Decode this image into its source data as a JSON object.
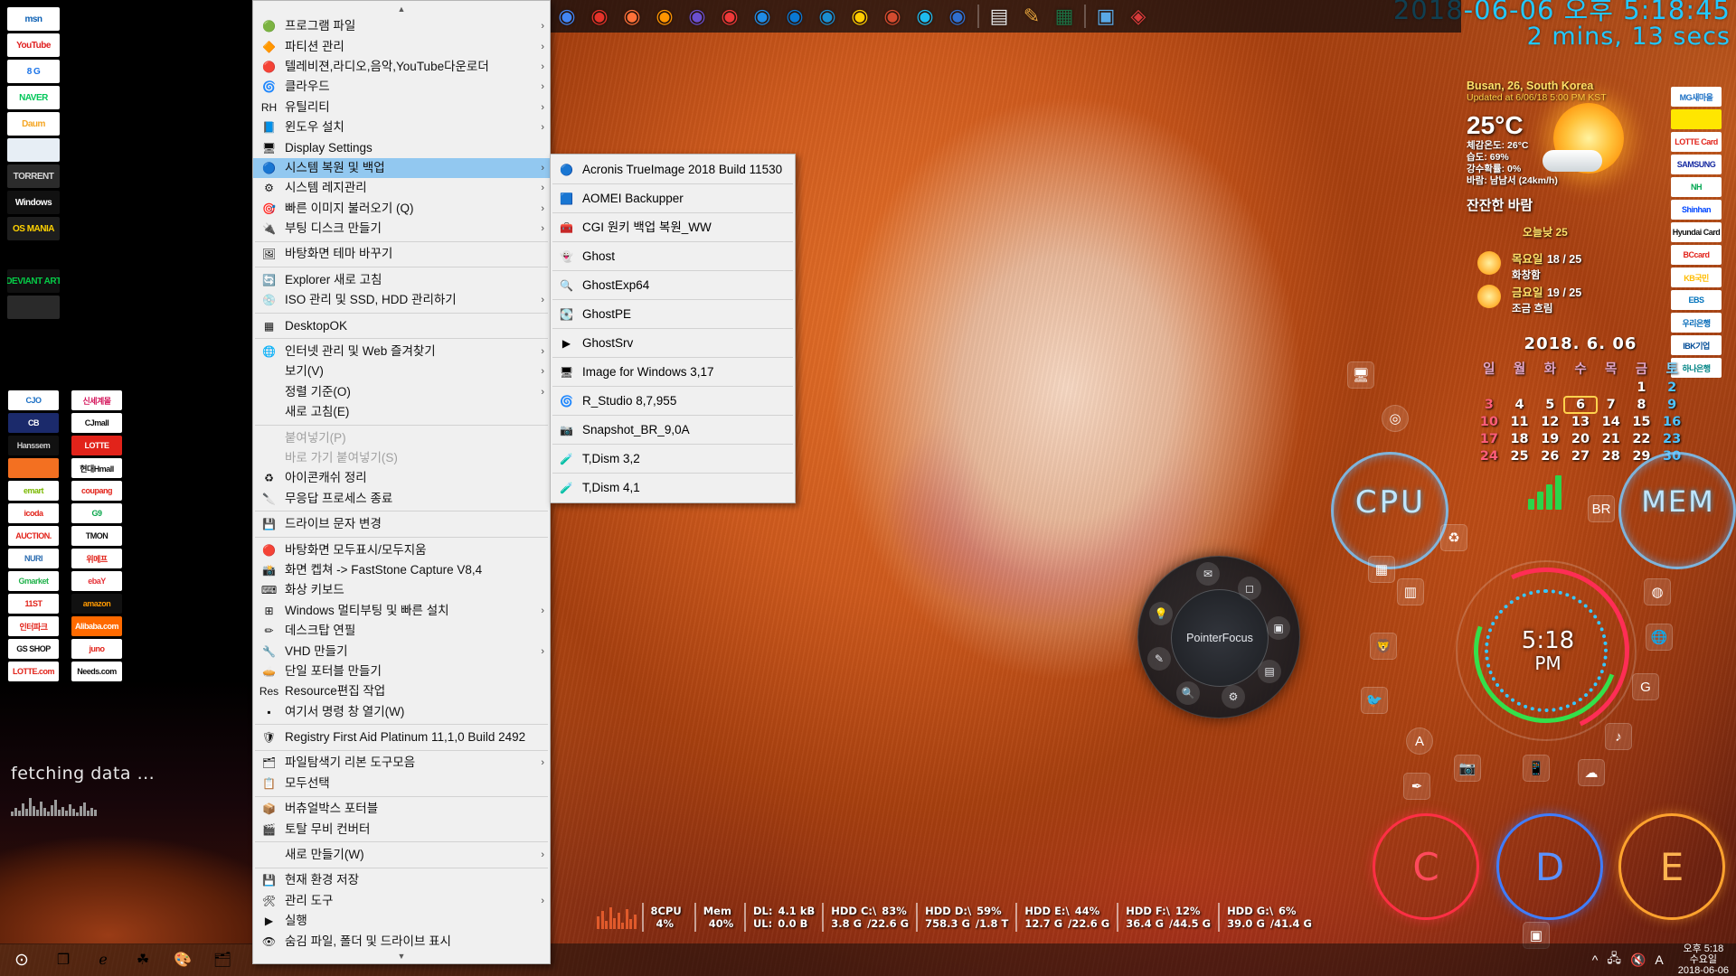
{
  "desktop": {
    "datetime_overlay": {
      "line1": "2018-06-06 오후 5:18:45",
      "line2": "2 mins, 13 secs"
    },
    "fetching": {
      "title": "fetching data ..."
    }
  },
  "icons_left_col1": [
    {
      "name": "msn",
      "label": "msn",
      "bg": "#ffffff",
      "fg": "#0a5fb4"
    },
    {
      "name": "youtube",
      "label": "YouTube",
      "bg": "#ffffff",
      "fg": "#e02020"
    },
    {
      "name": "google",
      "label": "8  G",
      "bg": "#ffffff",
      "fg": "#1a73e8"
    },
    {
      "name": "naver",
      "label": "NAVER",
      "bg": "#ffffff",
      "fg": "#03c75a"
    },
    {
      "name": "daum",
      "label": "Daum",
      "bg": "#ffffff",
      "fg": "#f5a623"
    },
    {
      "name": "news-portal",
      "label": "",
      "bg": "#e7eef5",
      "fg": "#333333"
    },
    {
      "name": "torrent",
      "label": "TORRENT",
      "bg": "#2b2b2b",
      "fg": "#d8d8d8"
    },
    {
      "name": "windows-forum",
      "label": "Windows",
      "bg": "#111111",
      "fg": "#ffffff"
    },
    {
      "name": "os-mania",
      "label": "OS MANIA",
      "bg": "#1e1e1e",
      "fg": "#ffd200"
    },
    {
      "name": "windows-logo",
      "label": "",
      "bg": "#000000",
      "fg": "#35b7f0"
    },
    {
      "name": "deviantart",
      "label": "DEVIANT ART",
      "bg": "#111111",
      "fg": "#05cc47"
    },
    {
      "name": "obsidian",
      "label": "",
      "bg": "#2a2a2a",
      "fg": "#cccccc"
    },
    {
      "name": "red-bird",
      "label": "",
      "bg": "#000000",
      "fg": "#d14a32"
    },
    {
      "name": "korea-flag",
      "label": "",
      "bg": "#000000",
      "fg": "#ffffff"
    }
  ],
  "icons_shop_col1": [
    {
      "name": "cjo",
      "label": "CJO",
      "bg": "#ffffff",
      "fg": "#1a6fc4"
    },
    {
      "name": "cb-mall",
      "label": "CB",
      "bg": "#1b2a6b",
      "fg": "#ffffff"
    },
    {
      "name": "hanssem",
      "label": "Hanssem",
      "bg": "#111111",
      "fg": "#cccccc"
    },
    {
      "name": "ssg-orange",
      "label": "",
      "bg": "#f37021",
      "fg": "#ffffff"
    },
    {
      "name": "emart-mall",
      "label": "emart",
      "bg": "#ffffff",
      "fg": "#7ab800"
    },
    {
      "name": "icoda",
      "label": "icoda",
      "bg": "#ffffff",
      "fg": "#e2231a"
    },
    {
      "name": "auction",
      "label": "AUCTION.",
      "bg": "#ffffff",
      "fg": "#e2231a"
    },
    {
      "name": "nuri",
      "label": "NURI",
      "bg": "#ffffff",
      "fg": "#2b6cb0"
    },
    {
      "name": "gmarket",
      "label": "Gmarket",
      "bg": "#ffffff",
      "fg": "#21b24b"
    },
    {
      "name": "11st",
      "label": "11ST",
      "bg": "#ffffff",
      "fg": "#e2231a"
    },
    {
      "name": "interpark",
      "label": "인터파크",
      "bg": "#ffffff",
      "fg": "#e2231a"
    },
    {
      "name": "gsshop",
      "label": "GS SHOP",
      "bg": "#ffffff",
      "fg": "#111111"
    },
    {
      "name": "lotte-com",
      "label": "LOTTE.com",
      "bg": "#ffffff",
      "fg": "#e2231a"
    }
  ],
  "icons_shop_col2": [
    {
      "name": "shinsegae",
      "label": "신세계몰",
      "bg": "#ffffff",
      "fg": "#d4145a"
    },
    {
      "name": "cjmall",
      "label": "CJmall",
      "bg": "#ffffff",
      "fg": "#111111"
    },
    {
      "name": "lotte-homeshopping",
      "label": "LOTTE",
      "bg": "#e2231a",
      "fg": "#ffffff"
    },
    {
      "name": "hmall",
      "label": "현대Hmall",
      "bg": "#ffffff",
      "fg": "#111111"
    },
    {
      "name": "coupang",
      "label": "coupang",
      "bg": "#ffffff",
      "fg": "#e2231a"
    },
    {
      "name": "g9",
      "label": "G9",
      "bg": "#ffffff",
      "fg": "#0aa64b"
    },
    {
      "name": "tmon",
      "label": "TMON",
      "bg": "#ffffff",
      "fg": "#111111"
    },
    {
      "name": "wemakeprice",
      "label": "위메프",
      "bg": "#ffffff",
      "fg": "#e2231a"
    },
    {
      "name": "ebay",
      "label": "ebaY",
      "bg": "#ffffff",
      "fg": "#e53238"
    },
    {
      "name": "amazon",
      "label": "amazon",
      "bg": "#111111",
      "fg": "#ff9900"
    },
    {
      "name": "alibaba",
      "label": "Alibaba.com",
      "bg": "#ff6a00",
      "fg": "#ffffff"
    },
    {
      "name": "hmall-juno",
      "label": "juno",
      "bg": "#ffffff",
      "fg": "#e2231a"
    },
    {
      "name": "needsgom",
      "label": "Needs.com",
      "bg": "#ffffff",
      "fg": "#111111"
    }
  ],
  "icons_right_rail": [
    {
      "name": "mg-saemaeul",
      "label": "MG새마을",
      "bg": "#ffffff",
      "fg": "#1a6fc4"
    },
    {
      "name": "kakao-bank",
      "label": "",
      "bg": "#ffe600",
      "fg": "#3c1e1e"
    },
    {
      "name": "lotte-card",
      "label": "LOTTE Card",
      "bg": "#ffffff",
      "fg": "#e2231a"
    },
    {
      "name": "samsung-card",
      "label": "SAMSUNG",
      "bg": "#ffffff",
      "fg": "#1428a0"
    },
    {
      "name": "nh-bank",
      "label": "NH",
      "bg": "#ffffff",
      "fg": "#00a650"
    },
    {
      "name": "shinhan",
      "label": "Shinhan",
      "bg": "#ffffff",
      "fg": "#0046ff"
    },
    {
      "name": "hyundai-card",
      "label": "Hyundai Card",
      "bg": "#ffffff",
      "fg": "#111111"
    },
    {
      "name": "bc-card",
      "label": "BCcard",
      "bg": "#ffffff",
      "fg": "#e2231a"
    },
    {
      "name": "kb-card",
      "label": "KB국민",
      "bg": "#ffffff",
      "fg": "#ffbc00"
    },
    {
      "name": "ebs",
      "label": "EBS",
      "bg": "#ffffff",
      "fg": "#0072bc"
    },
    {
      "name": "woori-bank",
      "label": "우리은행",
      "bg": "#ffffff",
      "fg": "#0068b7"
    },
    {
      "name": "ibk",
      "label": "IBK기업",
      "bg": "#ffffff",
      "fg": "#004c97"
    },
    {
      "name": "hana-bank",
      "label": "하나은행",
      "bg": "#ffffff",
      "fg": "#008485"
    }
  ],
  "quicklaunch": {
    "items": [
      {
        "name": "chrome",
        "glyph": "◉",
        "color": "#4285f4"
      },
      {
        "name": "opera",
        "glyph": "◉",
        "color": "#e5332a"
      },
      {
        "name": "firefox",
        "glyph": "◉",
        "color": "#ff7139"
      },
      {
        "name": "firefox-dev",
        "glyph": "◉",
        "color": "#ff9500"
      },
      {
        "name": "firefox-nightly",
        "glyph": "◉",
        "color": "#6a4fcf"
      },
      {
        "name": "vivaldi",
        "glyph": "◉",
        "color": "#ef3939"
      },
      {
        "name": "naver-whale",
        "glyph": "◉",
        "color": "#1f8ce6"
      },
      {
        "name": "edge",
        "glyph": "◉",
        "color": "#0a78d4"
      },
      {
        "name": "waterfox",
        "glyph": "◉",
        "color": "#1a8ed1"
      },
      {
        "name": "yandex",
        "glyph": "◉",
        "color": "#ffcc00"
      },
      {
        "name": "torch",
        "glyph": "◉",
        "color": "#d44b2f"
      },
      {
        "name": "internet-explorer",
        "glyph": "◉",
        "color": "#1ebbee"
      },
      {
        "name": "maxthon",
        "glyph": "◉",
        "color": "#2f6fd0"
      },
      {
        "name": "notepad",
        "glyph": "▤",
        "color": "#e8e8e8"
      },
      {
        "name": "pencil",
        "glyph": "✎",
        "color": "#e8a33d"
      },
      {
        "name": "excel",
        "glyph": "▦",
        "color": "#1d6f42"
      },
      {
        "name": "folder-blue",
        "glyph": "▣",
        "color": "#5aa9e6"
      },
      {
        "name": "app-red",
        "glyph": "◈",
        "color": "#d93b3b"
      }
    ]
  },
  "context_menu": {
    "items": [
      {
        "label": "프로그램 파일",
        "icon": "🟢",
        "arrow": true,
        "sep_after": false
      },
      {
        "label": "파티션 관리",
        "icon": "🔶",
        "arrow": true
      },
      {
        "label": "텔레비젼,라디오,음악,YouTube다운로더",
        "icon": "🔴",
        "arrow": true
      },
      {
        "label": "클라우드",
        "icon": "🌀",
        "arrow": true
      },
      {
        "label": "유틸리티",
        "icon": "RH",
        "arrow": true
      },
      {
        "label": "윈도우 설치",
        "icon": "📘",
        "arrow": true
      },
      {
        "label": "Display Settings",
        "icon": "🖥",
        "arrow": false
      },
      {
        "label": "시스템 복원 및 백업",
        "icon": "🔵",
        "arrow": true,
        "selected": true
      },
      {
        "label": "시스템 레지관리",
        "icon": "⚙",
        "arrow": true
      },
      {
        "label": "빠른 이미지 불러오기 (Q)",
        "icon": "🎯",
        "arrow": true
      },
      {
        "label": "부팅 디스크 만들기",
        "icon": "🔌",
        "arrow": true,
        "sep_after": true
      },
      {
        "label": "바탕화면 테마 바꾸기",
        "icon": "🖼",
        "arrow": false,
        "sep_after": true
      },
      {
        "label": "Explorer 새로 고침",
        "icon": "🔄",
        "arrow": false
      },
      {
        "label": "ISO 관리 및 SSD, HDD 관리하기",
        "icon": "💿",
        "arrow": true,
        "sep_after": true
      },
      {
        "label": "DesktopOK",
        "icon": "▦",
        "arrow": false,
        "sep_after": true
      },
      {
        "label": "인터넷 관리 및 Web 즐겨찾기",
        "icon": "🌐",
        "arrow": true
      },
      {
        "label": "보기(V)",
        "icon": "",
        "arrow": true
      },
      {
        "label": "정렬 기준(O)",
        "icon": "",
        "arrow": true
      },
      {
        "label": "새로 고침(E)",
        "icon": "",
        "arrow": false,
        "sep_after": true
      },
      {
        "label": "붙여넣기(P)",
        "icon": "",
        "arrow": false,
        "disabled": true
      },
      {
        "label": "바로 가기 붙여넣기(S)",
        "icon": "",
        "arrow": false,
        "disabled": true
      },
      {
        "label": "아이콘캐쉬 정리",
        "icon": "♻",
        "arrow": false
      },
      {
        "label": "무응답 프로세스 종료",
        "icon": "🔪",
        "arrow": false,
        "sep_after": true
      },
      {
        "label": "드라이브 문자 변경",
        "icon": "💾",
        "arrow": false,
        "sep_after": true
      },
      {
        "label": "바탕화면 모두표시/모두지움",
        "icon": "🔴",
        "arrow": false
      },
      {
        "label": "화면 켑쳐 -> FastStone Capture V8,4",
        "icon": "📸",
        "arrow": false
      },
      {
        "label": "화상 키보드",
        "icon": "⌨",
        "arrow": false
      },
      {
        "label": "Windows 멀티부팅 및 빠른 설치",
        "icon": "⊞",
        "arrow": true
      },
      {
        "label": "데스크탑 연필",
        "icon": "✏",
        "arrow": false
      },
      {
        "label": "VHD 만들기",
        "icon": "🔧",
        "arrow": true
      },
      {
        "label": "단일 포터블 만들기",
        "icon": "🥧",
        "arrow": false
      },
      {
        "label": "Resource편집 작업",
        "icon": "Res",
        "arrow": false
      },
      {
        "label": "여기서 명령 창 열기(W)",
        "icon": "▪",
        "arrow": false,
        "sep_after": true
      },
      {
        "label": "Registry First Aid Platinum 11,1,0 Build 2492",
        "icon": "🛡",
        "arrow": false,
        "sep_after": true
      },
      {
        "label": "파일탐색기 리본 도구모음",
        "icon": "🗂",
        "arrow": true
      },
      {
        "label": "모두선택",
        "icon": "📋",
        "arrow": false,
        "sep_after": true
      },
      {
        "label": "버츄얼박스 포터블",
        "icon": "📦",
        "arrow": false
      },
      {
        "label": "토탈 무비 컨버터",
        "icon": "🎬",
        "arrow": false,
        "sep_after": true
      },
      {
        "label": "새로 만들기(W)",
        "icon": "",
        "arrow": true,
        "sep_after": true
      },
      {
        "label": "현재 환경 저장",
        "icon": "💾",
        "arrow": false
      },
      {
        "label": "관리 도구",
        "icon": "🛠",
        "arrow": true
      },
      {
        "label": "실행",
        "icon": "▶",
        "arrow": false
      },
      {
        "label": "숨김 파일, 폴더 및 드라이브 표시",
        "icon": "👁",
        "arrow": false
      }
    ]
  },
  "submenu": {
    "title": "시스템 복원 및 백업",
    "items": [
      {
        "label": "Acronis TrueImage 2018 Build 11530",
        "icon": "🔵"
      },
      {
        "label": "AOMEI Backupper",
        "icon": "🟦"
      },
      {
        "label": "CGI 원키 백업 복원_WW",
        "icon": "🧰"
      },
      {
        "label": "Ghost",
        "icon": "👻"
      },
      {
        "label": "GhostExp64",
        "icon": "🔍"
      },
      {
        "label": "GhostPE",
        "icon": "💽"
      },
      {
        "label": "GhostSrv",
        "icon": "▶"
      },
      {
        "label": "Image for Windows 3,17",
        "icon": "🖥"
      },
      {
        "label": "R_Studio 8,7,955",
        "icon": "🌀"
      },
      {
        "label": "Snapshot_BR_9,0A",
        "icon": "📷"
      },
      {
        "label": "T,Dism 3,2",
        "icon": "🧪"
      },
      {
        "label": "T,Dism 4,1",
        "icon": "🧪"
      }
    ]
  },
  "weather": {
    "location": "Busan, 26, South Korea",
    "updated": "Updated at 6/06/18 5:00 PM KST",
    "temperature": "25°C",
    "feels_like": "체감온도: 26°C",
    "humidity": "습도: 69%",
    "precipitation": "강수확률: 0%",
    "wind": "바람: 남남서 (24km/h)",
    "condition": "잔잔한 바람",
    "today_high_label": "오늘낮",
    "today_high": "25",
    "forecast": [
      {
        "day": "목요일",
        "range": "18 / 25",
        "desc": "화창함"
      },
      {
        "day": "금요일",
        "range": "19 / 25",
        "desc": "조금 흐림"
      }
    ]
  },
  "calendar": {
    "title": "2018. 6. 06",
    "weekdays": [
      "일",
      "월",
      "화",
      "수",
      "목",
      "금",
      "토"
    ],
    "weeks": [
      [
        "",
        "",
        "",
        "",
        "",
        "1",
        "2"
      ],
      [
        "3",
        "4",
        "5",
        "6",
        "7",
        "8",
        "9"
      ],
      [
        "10",
        "11",
        "12",
        "13",
        "14",
        "15",
        "16"
      ],
      [
        "17",
        "18",
        "19",
        "20",
        "21",
        "22",
        "23"
      ],
      [
        "24",
        "25",
        "26",
        "27",
        "28",
        "29",
        "30"
      ]
    ],
    "today": "6"
  },
  "gadgets": {
    "cpu_label": "CPU",
    "mem_label": "MEM",
    "clock_time": "5:18",
    "clock_ampm": "PM",
    "drives": [
      {
        "letter": "C",
        "color": "#ff2f45"
      },
      {
        "letter": "D",
        "color": "#3f7dff"
      },
      {
        "letter": "E",
        "color": "#ffa32e"
      }
    ],
    "pointerfocus_label": "PointerFocus",
    "pointerfocus_buttons": [
      {
        "name": "mail",
        "glyph": "✉"
      },
      {
        "name": "eraser",
        "glyph": "◻"
      },
      {
        "name": "screenshot",
        "glyph": "▣"
      },
      {
        "name": "message",
        "glyph": "💬"
      },
      {
        "name": "settings",
        "glyph": "⚙"
      },
      {
        "name": "zoom",
        "glyph": "🔍"
      },
      {
        "name": "pen",
        "glyph": "✎"
      },
      {
        "name": "bulb",
        "glyph": "💡"
      }
    ]
  },
  "stats_bar": [
    {
      "name": "cpu",
      "k1": "8CPU",
      "v1": "",
      "k2": "",
      "v2": "4%"
    },
    {
      "name": "mem",
      "k1": "Mem",
      "v1": "",
      "k2": "",
      "v2": "40%"
    },
    {
      "name": "net",
      "k1": "DL:",
      "v1": "4.1 kB",
      "k2": "UL:",
      "v2": "0.0 B"
    },
    {
      "name": "hdd-c",
      "k1": "HDD C:\\",
      "v1": "83%",
      "k2": "3.8 G",
      "v2": "/22.6 G"
    },
    {
      "name": "hdd-d",
      "k1": "HDD D:\\",
      "v1": "59%",
      "k2": "758.3 G",
      "v2": "/1.8 T"
    },
    {
      "name": "hdd-e",
      "k1": "HDD E:\\",
      "v1": "44%",
      "k2": "12.7 G",
      "v2": "/22.6 G"
    },
    {
      "name": "hdd-f",
      "k1": "HDD F:\\",
      "v1": "12%",
      "k2": "36.4 G",
      "v2": "/44.5 G"
    },
    {
      "name": "hdd-g",
      "k1": "HDD G:\\",
      "v1": "6%",
      "k2": "39.0 G",
      "v2": "/41.4 G"
    }
  ],
  "taskbar": {
    "start_glyph": "⊙",
    "items": [
      {
        "name": "taskview",
        "glyph": "❐"
      },
      {
        "name": "internet-explorer",
        "glyph": "ℯ"
      },
      {
        "name": "clover",
        "glyph": "☘"
      },
      {
        "name": "paint",
        "glyph": "🎨"
      },
      {
        "name": "folder",
        "glyph": "🗂"
      }
    ],
    "tray": [
      {
        "name": "show-hidden-icons",
        "glyph": "^"
      },
      {
        "name": "network",
        "glyph": "🖧"
      },
      {
        "name": "volume-muted",
        "glyph": "🔇"
      },
      {
        "name": "ime-language",
        "glyph": "A"
      }
    ],
    "clock": {
      "time": "오후 5:18",
      "day": "수요일",
      "date": "2018-06-06"
    }
  }
}
